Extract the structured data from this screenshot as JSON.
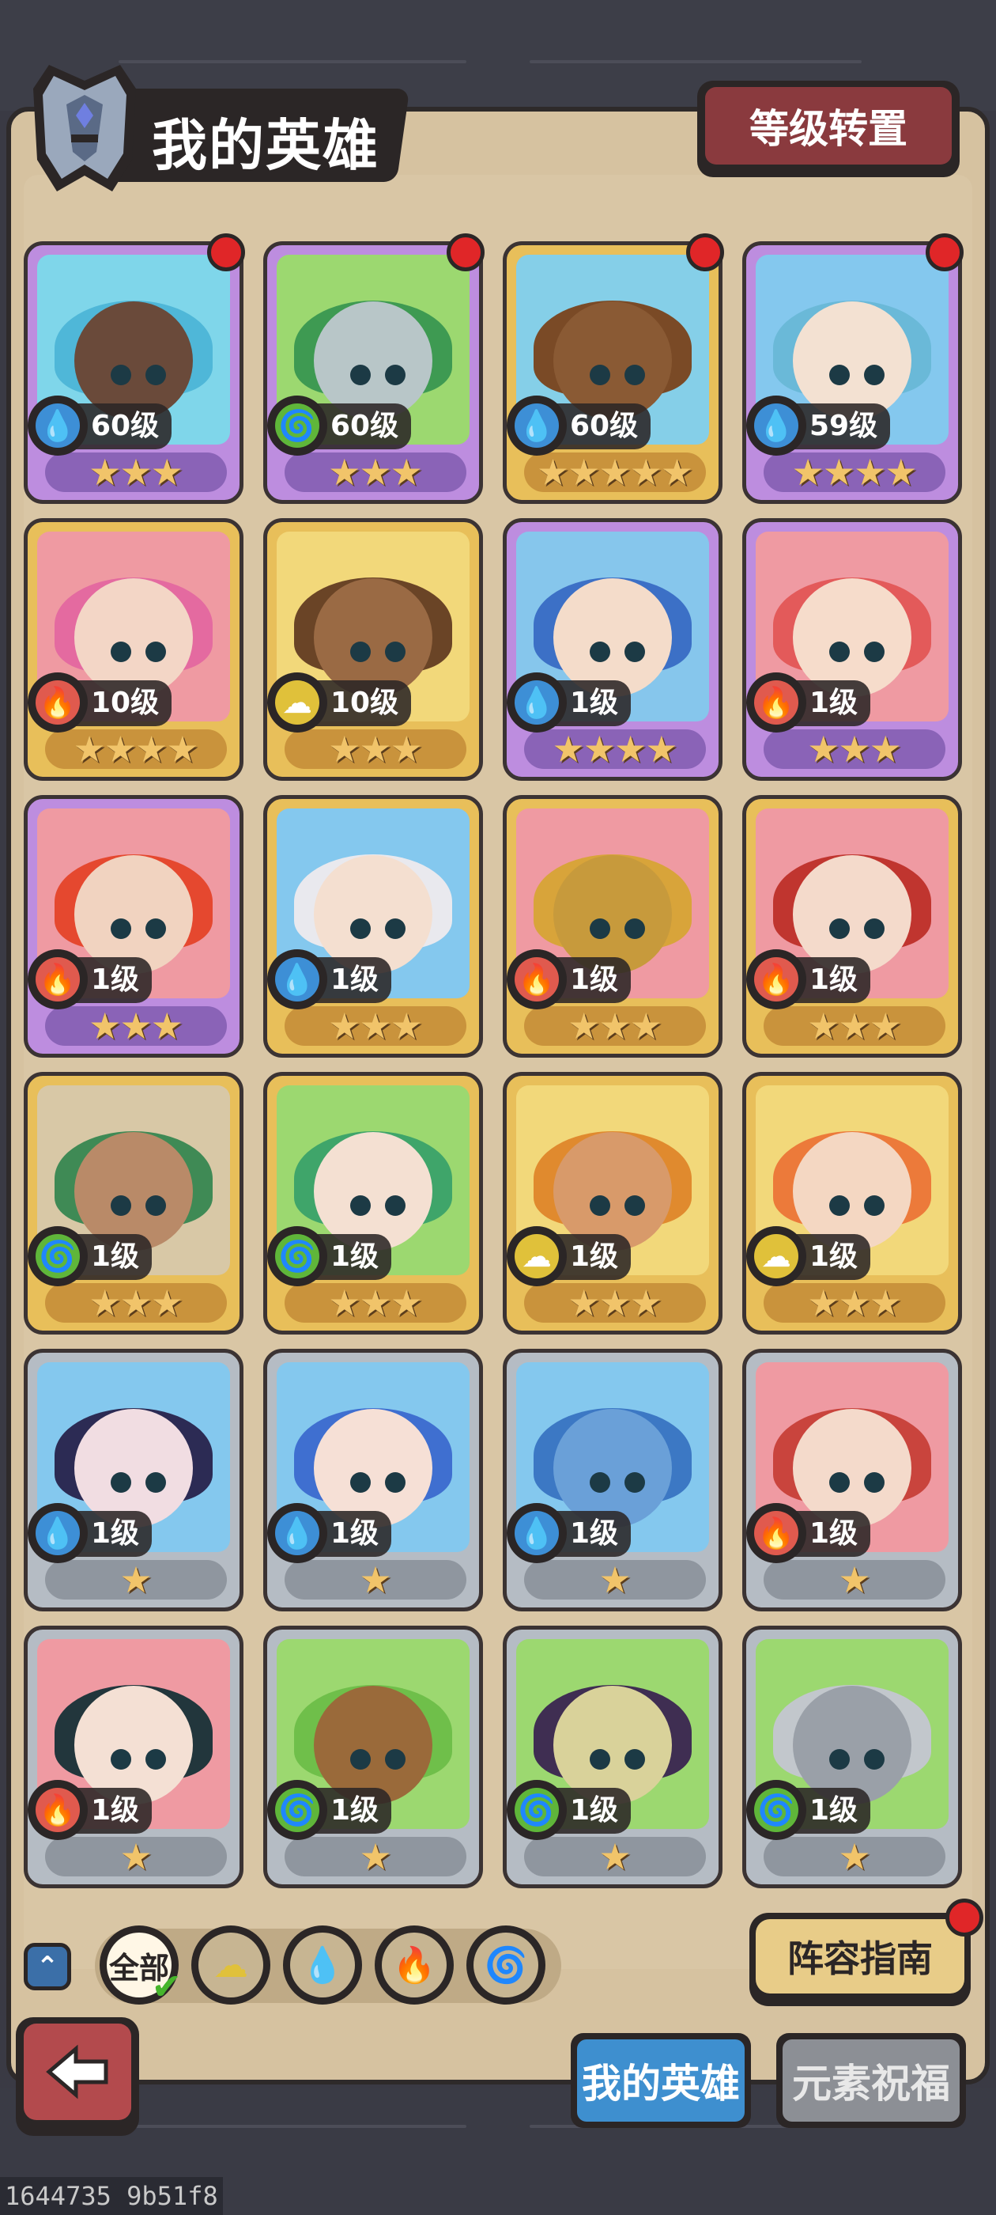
{
  "header": {
    "title": "我的英雄",
    "level_transfer_label": "等级转置"
  },
  "colors": {
    "water": "#3d8fd6",
    "fire": "#e05a4e",
    "wind": "#5fb63a",
    "earth": "#e0c13a",
    "card_gold": "#e8bf5a",
    "card_purple": "#bd8ddf",
    "card_silver": "#b5bcc4",
    "notification_red": "#e02628"
  },
  "heroes": [
    {
      "level": "60级",
      "element": "water",
      "stars": 3,
      "frame": "purple",
      "notify": true,
      "skin": "#6a4a3a",
      "hair": "#4fb7d8",
      "bg": "#7fd6ea"
    },
    {
      "level": "60级",
      "element": "wind",
      "stars": 3,
      "frame": "purple",
      "notify": true,
      "skin": "#b8c6c8",
      "hair": "#3e9a52",
      "bg": "#9cd870"
    },
    {
      "level": "60级",
      "element": "water",
      "stars": 5,
      "frame": "gold",
      "notify": true,
      "skin": "#8a5a34",
      "hair": "#7a4a26",
      "bg": "#85cfe8"
    },
    {
      "level": "59级",
      "element": "water",
      "stars": 4,
      "frame": "purple",
      "notify": true,
      "skin": "#f3e1d2",
      "hair": "#6ab9d8",
      "bg": "#84c8ee"
    },
    {
      "level": "10级",
      "element": "fire",
      "stars": 4,
      "frame": "gold",
      "notify": false,
      "skin": "#f3d6c6",
      "hair": "#e46aa0",
      "bg": "#ef9aa2"
    },
    {
      "level": "10级",
      "element": "earth",
      "stars": 3,
      "frame": "gold",
      "notify": false,
      "skin": "#9a6a44",
      "hair": "#6a4426",
      "bg": "#f2d87a"
    },
    {
      "level": "1级",
      "element": "water",
      "stars": 4,
      "frame": "purple",
      "notify": false,
      "skin": "#f4dcca",
      "hair": "#3c70c6",
      "bg": "#86c6ec"
    },
    {
      "level": "1级",
      "element": "fire",
      "stars": 3,
      "frame": "purple",
      "notify": false,
      "skin": "#f6dccb",
      "hair": "#e35a5a",
      "bg": "#ef9aa2"
    },
    {
      "level": "1级",
      "element": "fire",
      "stars": 3,
      "frame": "purple",
      "notify": false,
      "skin": "#f1d3c0",
      "hair": "#e5482f",
      "bg": "#ef9aa2"
    },
    {
      "level": "1级",
      "element": "water",
      "stars": 3,
      "frame": "gold",
      "notify": false,
      "skin": "#f4dfd0",
      "hair": "#e9e9ee",
      "bg": "#84c8ee"
    },
    {
      "level": "1级",
      "element": "fire",
      "stars": 3,
      "frame": "gold",
      "notify": false,
      "skin": "#c79a3c",
      "hair": "#d8a43a",
      "bg": "#ef9aa2"
    },
    {
      "level": "1级",
      "element": "fire",
      "stars": 3,
      "frame": "gold",
      "notify": false,
      "skin": "#f4dacb",
      "hair": "#c0352f",
      "bg": "#ef9aa2"
    },
    {
      "level": "1级",
      "element": "wind",
      "stars": 3,
      "frame": "gold",
      "notify": false,
      "skin": "#b98a68",
      "hair": "#3f8a55",
      "bg": "#d8c8a6"
    },
    {
      "level": "1级",
      "element": "wind",
      "stars": 3,
      "frame": "gold",
      "notify": false,
      "skin": "#f4e0d2",
      "hair": "#3fa56a",
      "bg": "#9cd870"
    },
    {
      "level": "1级",
      "element": "earth",
      "stars": 3,
      "frame": "gold",
      "notify": false,
      "skin": "#d89a6a",
      "hair": "#e08a2e",
      "bg": "#f2d87a"
    },
    {
      "level": "1级",
      "element": "earth",
      "stars": 3,
      "frame": "gold",
      "notify": false,
      "skin": "#f4d7c2",
      "hair": "#ec7a3a",
      "bg": "#f2d87a"
    },
    {
      "level": "1级",
      "element": "water",
      "stars": 1,
      "frame": "silver",
      "notify": false,
      "skin": "#f1dde2",
      "hair": "#2c2b54",
      "bg": "#84c8ee"
    },
    {
      "level": "1级",
      "element": "water",
      "stars": 1,
      "frame": "silver",
      "notify": false,
      "skin": "#f6e0d6",
      "hair": "#3f6fd0",
      "bg": "#84c8ee"
    },
    {
      "level": "1级",
      "element": "water",
      "stars": 1,
      "frame": "silver",
      "notify": false,
      "skin": "#6aa0d8",
      "hair": "#3c78c4",
      "bg": "#84c8ee"
    },
    {
      "level": "1级",
      "element": "fire",
      "stars": 1,
      "frame": "silver",
      "notify": false,
      "skin": "#f4dacb",
      "hair": "#c9443d",
      "bg": "#ef9aa2"
    },
    {
      "level": "1级",
      "element": "fire",
      "stars": 1,
      "frame": "silver",
      "notify": false,
      "skin": "#f4e0d4",
      "hair": "#22363c",
      "bg": "#ef9aa2"
    },
    {
      "level": "1级",
      "element": "wind",
      "stars": 1,
      "frame": "silver",
      "notify": false,
      "skin": "#9a6a3a",
      "hair": "#6fbf4a",
      "bg": "#9cd870"
    },
    {
      "level": "1级",
      "element": "wind",
      "stars": 1,
      "frame": "silver",
      "notify": false,
      "skin": "#d9d29a",
      "hair": "#3f2e52",
      "bg": "#9cd870"
    },
    {
      "level": "1级",
      "element": "wind",
      "stars": 1,
      "frame": "silver",
      "notify": false,
      "skin": "#9aa0a8",
      "hair": "#c2c7cc",
      "bg": "#9cd870"
    }
  ],
  "filters": {
    "all_label": "全部",
    "elements": [
      "earth",
      "water",
      "fire",
      "wind"
    ]
  },
  "lineup_guide_label": "阵容指南",
  "tabs": {
    "my_heroes": "我的英雄",
    "element_blessing": "元素祝福"
  },
  "debug_text": "1644735 9b51f8"
}
